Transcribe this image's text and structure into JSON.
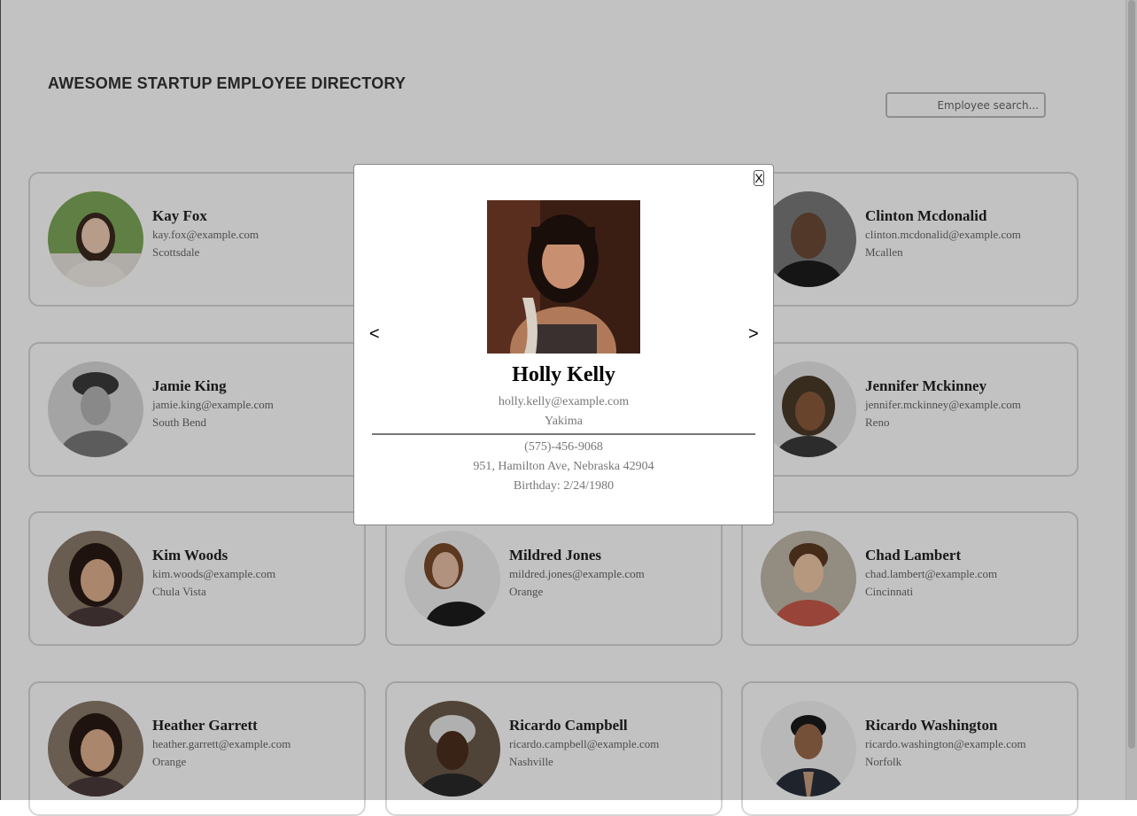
{
  "header": {
    "title": "AWESOME STARTUP EMPLOYEE DIRECTORY"
  },
  "search": {
    "placeholder": "Employee search..."
  },
  "employees": [
    {
      "name": "Kay Fox",
      "email": "kay.fox@example.com",
      "city": "Scottsdale"
    },
    {
      "name": "Clinton Mcdonalid",
      "email": "clinton.mcdonalid@example.com",
      "city": "Mcallen"
    },
    {
      "name": "Jamie King",
      "email": "jamie.king@example.com",
      "city": "South Bend"
    },
    {
      "name": "Jennifer Mckinney",
      "email": "jennifer.mckinney@example.com",
      "city": "Reno"
    },
    {
      "name": "Kim Woods",
      "email": "kim.woods@example.com",
      "city": "Chula Vista"
    },
    {
      "name": "Mildred Jones",
      "email": "mildred.jones@example.com",
      "city": "Orange"
    },
    {
      "name": "Chad Lambert",
      "email": "chad.lambert@example.com",
      "city": "Cincinnati"
    },
    {
      "name": "Heather Garrett",
      "email": "heather.garrett@example.com",
      "city": "Orange"
    },
    {
      "name": "Ricardo Campbell",
      "email": "ricardo.campbell@example.com",
      "city": "Nashville"
    },
    {
      "name": "Ricardo Washington",
      "email": "ricardo.washington@example.com",
      "city": "Norfolk"
    }
  ],
  "modal": {
    "close_label": "X",
    "prev_label": "<",
    "next_label": ">",
    "name": "Holly Kelly",
    "email": "holly.kelly@example.com",
    "city": "Yakima",
    "phone": "(575)-456-9068",
    "address": "951, Hamilton Ave, Nebraska 42904",
    "birthday": "Birthday: 2/24/1980"
  }
}
